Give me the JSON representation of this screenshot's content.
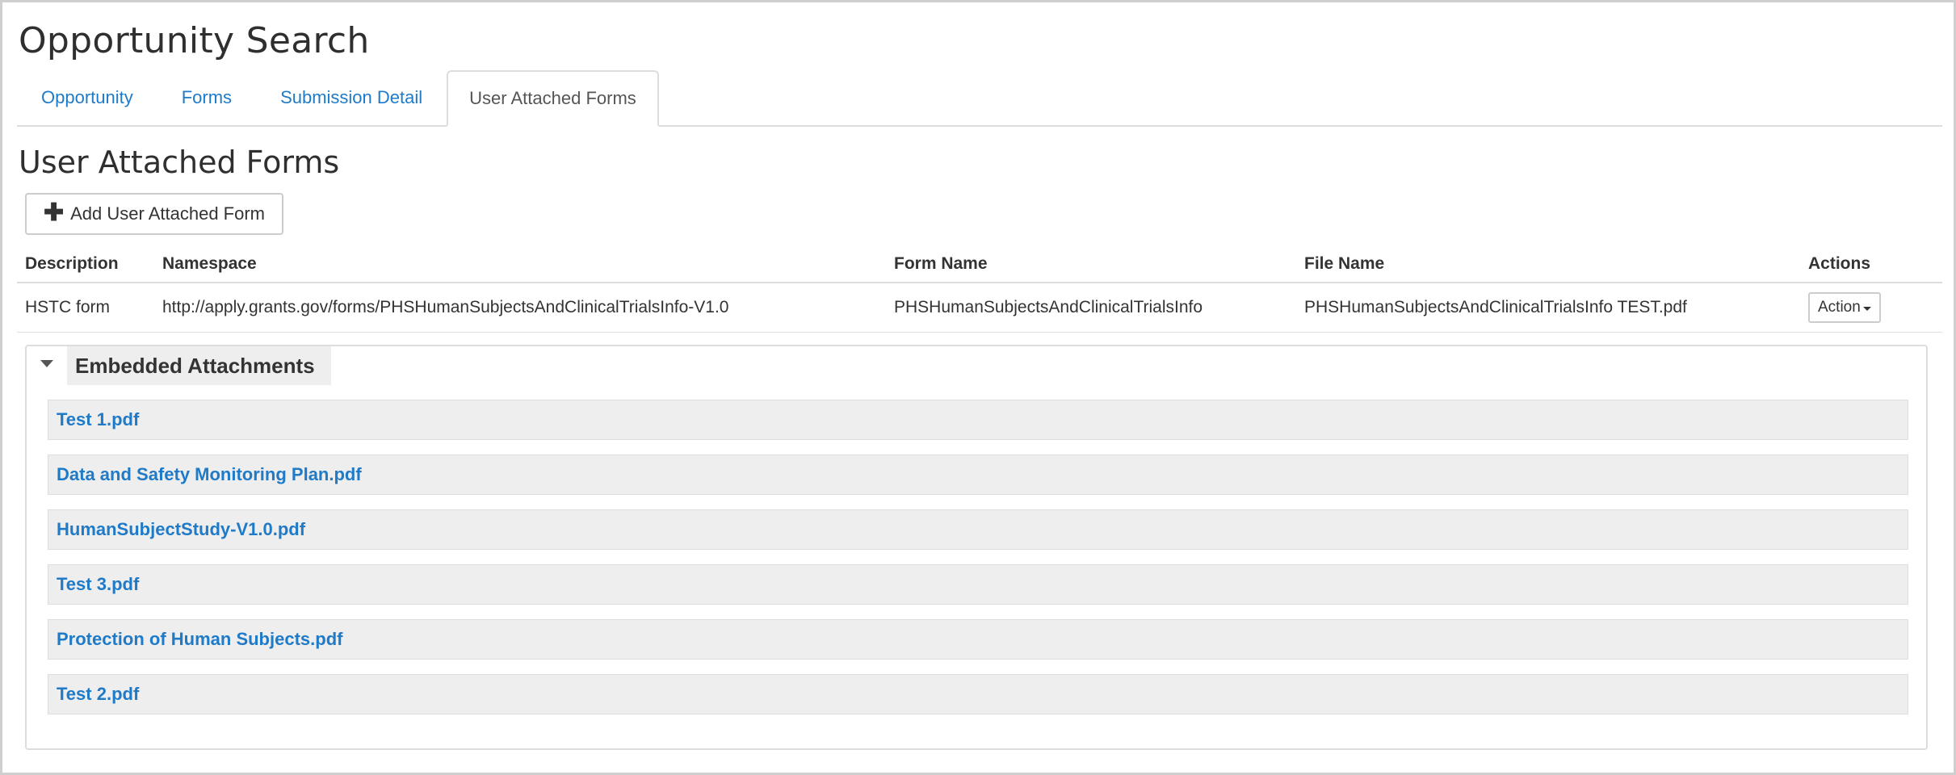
{
  "page": {
    "title": "Opportunity Search"
  },
  "tabs": [
    {
      "label": "Opportunity"
    },
    {
      "label": "Forms"
    },
    {
      "label": "Submission Detail"
    },
    {
      "label": "User Attached Forms",
      "active": true
    }
  ],
  "section": {
    "title": "User Attached Forms",
    "add_button_label": "Add User Attached Form",
    "add_button_icon": "plus-icon"
  },
  "table": {
    "headers": [
      "Description",
      "Namespace",
      "Form Name",
      "File Name",
      "Actions"
    ],
    "rows": [
      {
        "description": "HSTC form",
        "namespace": "http://apply.grants.gov/forms/PHSHumanSubjectsAndClinicalTrialsInfo-V1.0",
        "form_name": "PHSHumanSubjectsAndClinicalTrialsInfo",
        "file_name": "PHSHumanSubjectsAndClinicalTrialsInfo TEST.pdf",
        "action_label": "Action"
      }
    ]
  },
  "embedded": {
    "title": "Embedded Attachments",
    "expanded": true,
    "attachments": [
      "Test 1.pdf",
      "Data and Safety Monitoring Plan.pdf",
      "HumanSubjectStudy-V1.0.pdf",
      "Test 3.pdf",
      "Protection of Human Subjects.pdf",
      "Test 2.pdf"
    ]
  },
  "colors": {
    "link": "#1f7ac7",
    "panel_bg": "#eeeeee",
    "border": "#dddddd"
  }
}
